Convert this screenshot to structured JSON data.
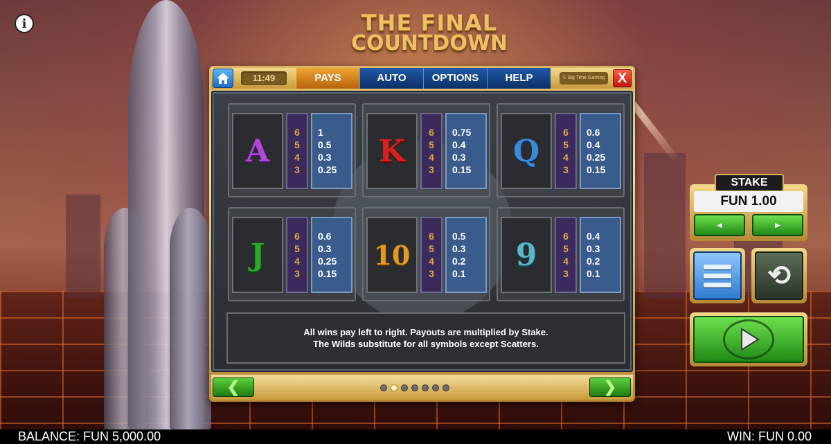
{
  "title": {
    "line1": "THE FINAL",
    "line2": "COUNTDOWN"
  },
  "topbar": {
    "clock": "11:49",
    "tabs": [
      {
        "label": "PAYS",
        "active": true
      },
      {
        "label": "AUTO",
        "active": false
      },
      {
        "label": "OPTIONS",
        "active": false
      },
      {
        "label": "HELP",
        "active": false
      }
    ],
    "credit": "© Big Time Gaming",
    "close": "X"
  },
  "paytable": [
    {
      "symbol": "A",
      "color": "#b248d8",
      "counts": [
        "6",
        "5",
        "4",
        "3"
      ],
      "pays": [
        "1",
        "0.5",
        "0.3",
        "0.25"
      ]
    },
    {
      "symbol": "K",
      "color": "#d82020",
      "counts": [
        "6",
        "5",
        "4",
        "3"
      ],
      "pays": [
        "0.75",
        "0.4",
        "0.3",
        "0.15"
      ]
    },
    {
      "symbol": "Q",
      "color": "#3a8ad8",
      "counts": [
        "6",
        "5",
        "4",
        "3"
      ],
      "pays": [
        "0.6",
        "0.4",
        "0.25",
        "0.15"
      ]
    },
    {
      "symbol": "J",
      "color": "#2aa82a",
      "counts": [
        "6",
        "5",
        "4",
        "3"
      ],
      "pays": [
        "0.6",
        "0.3",
        "0.25",
        "0.15"
      ]
    },
    {
      "symbol": "10",
      "color": "#d88a1a",
      "counts": [
        "6",
        "5",
        "4",
        "3"
      ],
      "pays": [
        "0.5",
        "0.3",
        "0.2",
        "0.1"
      ]
    },
    {
      "symbol": "9",
      "color": "#58b8c8",
      "counts": [
        "6",
        "5",
        "4",
        "3"
      ],
      "pays": [
        "0.4",
        "0.3",
        "0.2",
        "0.1"
      ]
    }
  ],
  "description": {
    "line1": "All wins pay left to right. Payouts are multiplied by Stake.",
    "line2": "The Wilds substitute for all symbols except Scatters."
  },
  "pagination": {
    "count": 7,
    "active": 1
  },
  "controls": {
    "stake_label": "STAKE",
    "stake_value": "FUN 1.00",
    "decrease": "◄",
    "increase": "►",
    "menu_icon": "menu-icon",
    "autoplay_icon": "repeat-icon",
    "spin_icon": "play-icon"
  },
  "footer": {
    "balance": "BALANCE: FUN 5,000.00",
    "win": "WIN: FUN 0.00"
  }
}
